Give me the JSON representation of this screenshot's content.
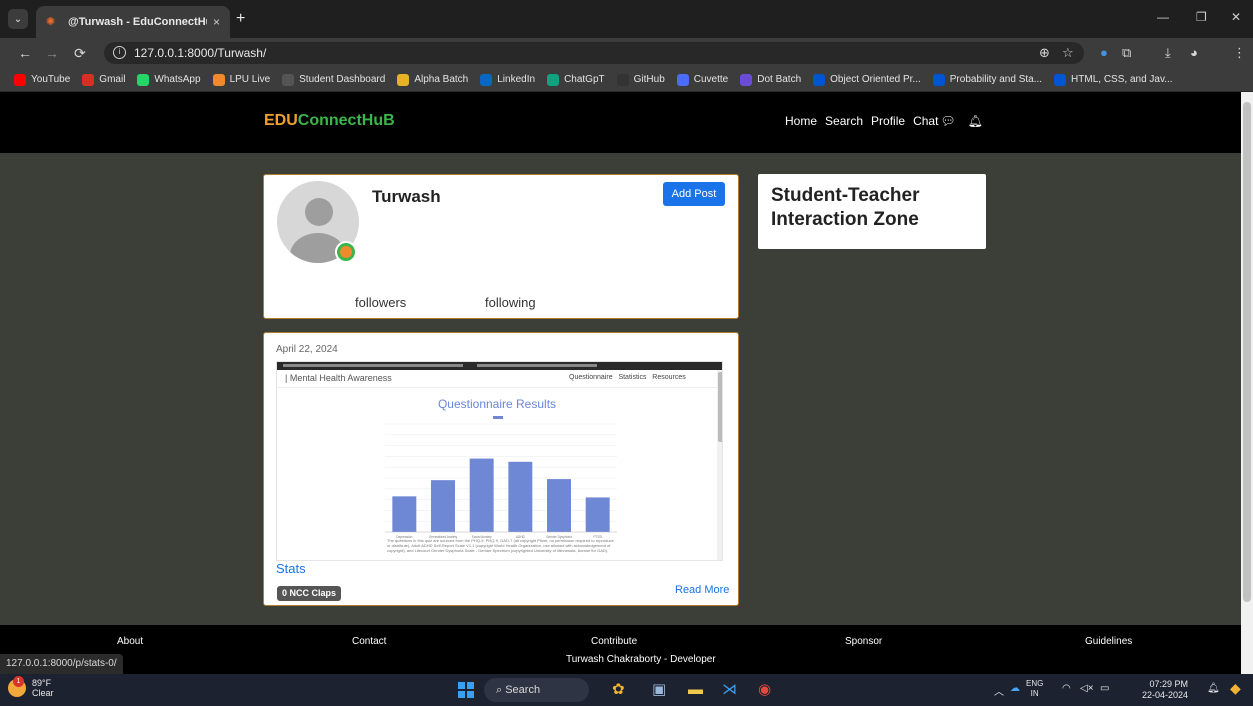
{
  "browser": {
    "tab_title": "@Turwash - EduConnectHub",
    "tab_close": "×",
    "new_tab": "+",
    "url": "127.0.0.1:8000/Turwash/",
    "bookmarks": [
      {
        "label": "YouTube",
        "icon": "youtube-icon",
        "color": "#ff0000"
      },
      {
        "label": "Gmail",
        "icon": "gmail-icon",
        "color": "#d93025"
      },
      {
        "label": "WhatsApp",
        "icon": "whatsapp-icon",
        "color": "#25d366"
      },
      {
        "label": "LPU Live",
        "icon": "lpu-icon",
        "color": "#f08a2c"
      },
      {
        "label": "Student Dashboard",
        "icon": "dashboard-icon",
        "color": "#555555"
      },
      {
        "label": "Alpha Batch",
        "icon": "alpha-icon",
        "color": "#e6b325"
      },
      {
        "label": "LinkedIn",
        "icon": "linkedin-icon",
        "color": "#0a66c2"
      },
      {
        "label": "ChatGpT",
        "icon": "chatgpt-icon",
        "color": "#10a37f"
      },
      {
        "label": "GitHub",
        "icon": "github-icon",
        "color": "#333333"
      },
      {
        "label": "Cuvette",
        "icon": "cuvette-icon",
        "color": "#4a6cf7"
      },
      {
        "label": "Dot Batch",
        "icon": "dot-icon",
        "color": "#6b4cd6"
      },
      {
        "label": "Object Oriented Pr...",
        "icon": "coursera-icon",
        "color": "#0056d2"
      },
      {
        "label": "Probability and Sta...",
        "icon": "coursera-icon",
        "color": "#0056d2"
      },
      {
        "label": "HTML, CSS, and Jav...",
        "icon": "coursera-icon",
        "color": "#0056d2"
      }
    ],
    "status_url": "127.0.0.1:8000/p/stats-0/"
  },
  "site": {
    "logo_part1": "EDU",
    "logo_part2": "ConnectHuB",
    "nav": [
      "Home",
      "Search",
      "Profile",
      "Chat"
    ],
    "logo_colors": {
      "edu": "#f0a030",
      "rest": "#3cb54b"
    }
  },
  "profile": {
    "username": "Turwash",
    "add_post_label": "Add Post",
    "followers_label": "followers",
    "following_label": "following"
  },
  "zone": {
    "title_line1": "Student-Teacher",
    "title_line2": "Interaction Zone"
  },
  "post": {
    "date": "April 22, 2024",
    "title": "Stats",
    "claps": "0 NCC Claps",
    "read_more": "Read More",
    "screenshot": {
      "brand": "| Mental Health Awareness",
      "links": [
        "Questionnaire",
        "Statistics",
        "Resources"
      ],
      "heading": "Questionnaire Results",
      "note": "The questions in this quiz are sourced from the PHQ-9, PHQ-9, GAD-7 (all copyright Pfizer, no permission required to reproduce or distribute), Adult ADHD Self-Report Scale V1.1 (copyright World Health Organization, use allowed with acknowledgement of copyright), and Lifecourt Gender Dysphoria Scale - Gender Spectrum (copyrighted University of Minnesota, license for GAD)."
    }
  },
  "chart_data": {
    "type": "bar",
    "categories": [
      "Depression",
      "Generalized Anxiety",
      "Social Anxiety",
      "ADHD",
      "Gender Dysphoria",
      "PTSD"
    ],
    "values": [
      33,
      48,
      68,
      65,
      49,
      32
    ],
    "ylim": [
      0,
      100
    ],
    "grid": true,
    "color": "#6f88d6"
  },
  "footer": {
    "links": [
      "About",
      "Contact",
      "Contribute",
      "Sponsor",
      "Guidelines"
    ],
    "developer": "Turwash Chakraborty - Developer"
  },
  "taskbar": {
    "temp": "89°F",
    "condition": "Clear",
    "weather_badge": "1",
    "search": "Search",
    "lang1": "ENG",
    "lang2": "IN",
    "time": "07:29 PM",
    "date": "22-04-2024"
  }
}
